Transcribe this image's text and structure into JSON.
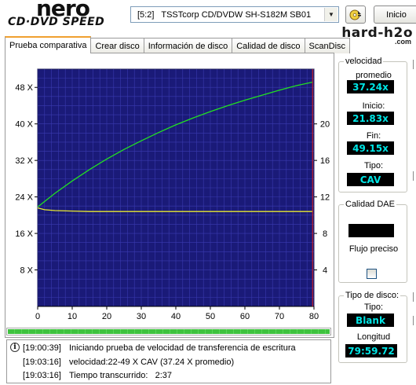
{
  "header": {
    "logo_top": "nero",
    "logo_bottom": "CD·DVD SPEED",
    "drive": "[5:2]   TSSTcorp CD/DVDW SH-S182M SB01",
    "start_label": "Inicio",
    "watermark": "hard-h2o",
    "watermark_sub": ".com"
  },
  "tabs": [
    {
      "label": "Prueba comparativa",
      "active": true
    },
    {
      "label": "Crear disco"
    },
    {
      "label": "Información de disco"
    },
    {
      "label": "Calidad de disco"
    },
    {
      "label": "ScanDisc"
    }
  ],
  "chart_data": {
    "type": "line",
    "background": "#1a1a78",
    "x_ticks": [
      "0",
      "10",
      "20",
      "30",
      "40",
      "50",
      "60",
      "70",
      "80"
    ],
    "xlim": [
      0,
      80
    ],
    "y_left_ticks": [
      "8 X",
      "16 X",
      "24 X",
      "32 X",
      "40 X",
      "48 X"
    ],
    "ylim_left": [
      0,
      52
    ],
    "y_right_ticks": [
      "4",
      "8",
      "12",
      "16",
      "20"
    ],
    "ylim_right": [
      0,
      26
    ],
    "grid": true,
    "end_marker_x": 79.6,
    "series": [
      {
        "color": "#22e022",
        "axis": "left",
        "x": [
          0,
          5,
          10,
          15,
          20,
          25,
          30,
          35,
          40,
          45,
          50,
          55,
          60,
          65,
          70,
          75,
          79.5
        ],
        "values": [
          21.8,
          24.8,
          27.5,
          30.0,
          32.3,
          34.4,
          36.3,
          38.1,
          39.8,
          41.3,
          42.7,
          44.0,
          45.2,
          46.3,
          47.4,
          48.4,
          49.15
        ]
      },
      {
        "color": "#e8e830",
        "axis": "right",
        "x": [
          0,
          2,
          5,
          10,
          15,
          20,
          25,
          30,
          35,
          40,
          45,
          50,
          55,
          60,
          65,
          70,
          75,
          79.5
        ],
        "values": [
          10.8,
          10.6,
          10.5,
          10.45,
          10.4,
          10.4,
          10.4,
          10.4,
          10.4,
          10.4,
          10.4,
          10.4,
          10.4,
          10.4,
          10.4,
          10.4,
          10.4,
          10.4
        ]
      }
    ]
  },
  "speed_panel": {
    "title": "velocidad",
    "average_label": "promedio",
    "average_value": "37.24x",
    "start_label": "Inicio:",
    "start_value": "21.83x",
    "end_label": "Fin:",
    "end_value": "49.15x",
    "type_label": "Tipo:",
    "type_value": "CAV"
  },
  "dae_panel": {
    "title": "Calidad DAE",
    "value": "",
    "accurate_label": "Flujo preciso",
    "accurate_checked": false
  },
  "disc_panel": {
    "title": "Tipo de disco:",
    "type_label": "Tipo:",
    "type_value": "Blank",
    "length_label": "Longitud",
    "length_value": "79:59.72"
  },
  "progress": {
    "value": 1.0
  },
  "log": [
    {
      "time": "[19:00:39]",
      "message": "Iniciando prueba de velocidad de transferencia de escritura",
      "icon": true
    },
    {
      "time": "[19:03:16]",
      "message": "velocidad:22-49 X CAV (37.24 X promedio)"
    },
    {
      "time": "[19:03:16]",
      "message": "Tiempo transcurrido:   2:37"
    }
  ]
}
